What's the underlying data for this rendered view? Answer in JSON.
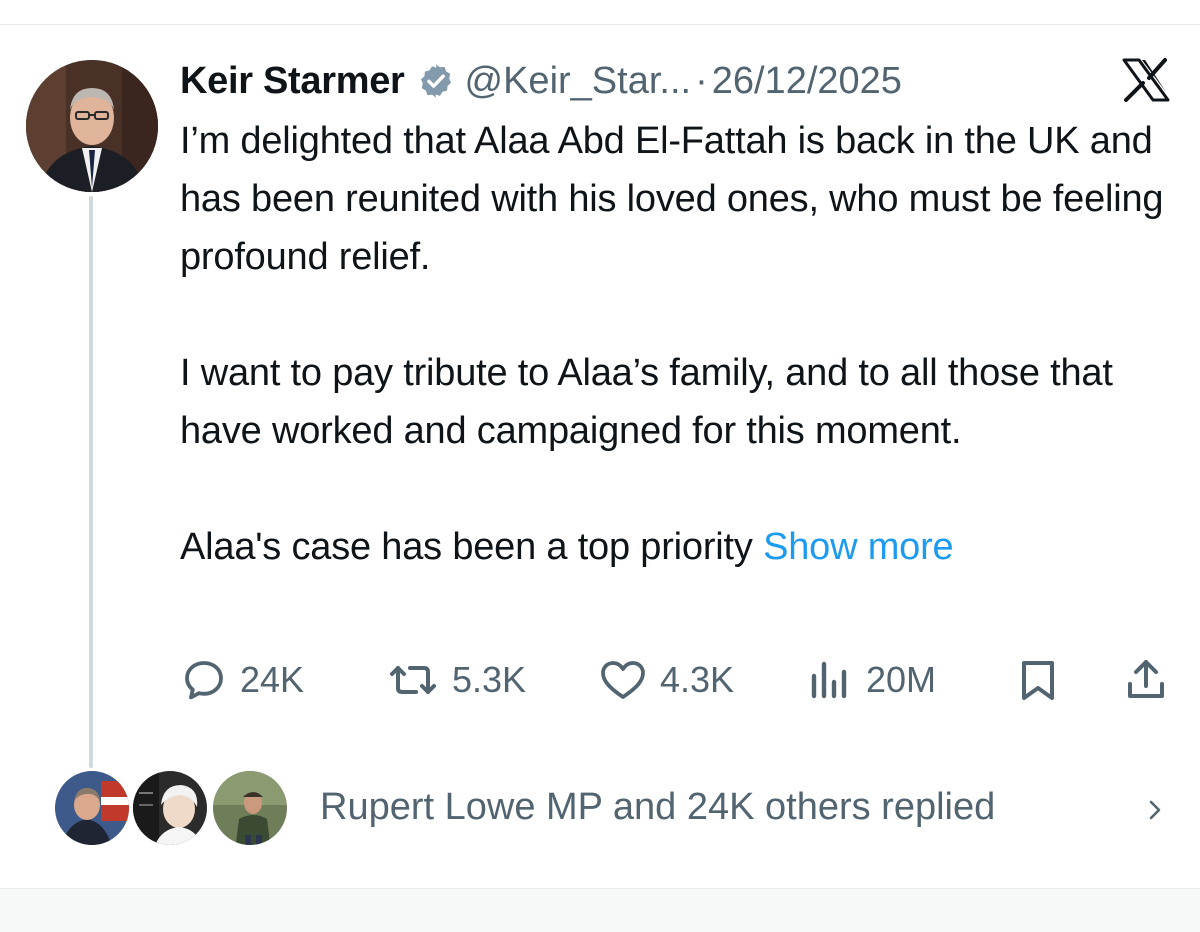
{
  "tweet": {
    "author_name": "Keir Starmer",
    "handle": "@Keir_Star...",
    "separator": "·",
    "date": "26/12/2025",
    "verified": true,
    "platform_logo": "x-logo-icon",
    "paragraphs": [
      "I’m delighted that Alaa Abd El-Fattah is back in the UK and has been reunited with his loved ones, who must be feeling profound relief.",
      "I want to pay tribute to Alaa’s family, and to all those that have worked and campaigned for this moment.",
      "Alaa's case has been a top priority"
    ],
    "show_more_label": "Show more"
  },
  "actions": {
    "replies": "24K",
    "reposts": "5.3K",
    "likes": "4.3K",
    "views": "20M"
  },
  "replies_summary": {
    "text": "Rupert Lowe MP and 24K others replied",
    "avatar_count": 3
  },
  "colors": {
    "text_primary": "#0f1419",
    "text_secondary": "#536471",
    "link": "#1d9bf0",
    "verified_badge": "#829aab",
    "thread_line": "#cfd9de",
    "top_card_border": "#e0245e"
  }
}
